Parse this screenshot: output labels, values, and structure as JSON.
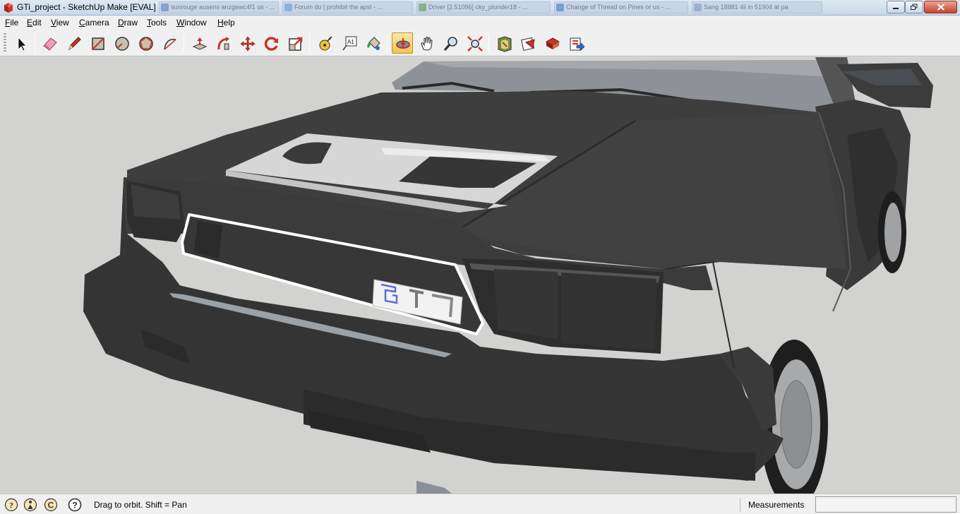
{
  "window": {
    "title": "GTi_project - SketchUp Make [EVAL]",
    "icon": "sketchup-app-icon",
    "background_tabs": [
      "sunrouge ausens anzgewc4f1 us - ...",
      "Forum do | prohibit the apsl - ...",
      "Driver [2.51096] cky_plunder18 - ...",
      "Change of Thread on Pines or us - ...",
      "Sang 18881 4li in 51904  at pa"
    ],
    "controls": [
      "minimize-icon",
      "restore-icon",
      "close-icon"
    ]
  },
  "menu": {
    "items": [
      {
        "label": "File",
        "accel": "F",
        "rest": "ile"
      },
      {
        "label": "Edit",
        "accel": "E",
        "rest": "dit"
      },
      {
        "label": "View",
        "accel": "V",
        "rest": "iew"
      },
      {
        "label": "Camera",
        "accel": "C",
        "rest": "amera"
      },
      {
        "label": "Draw",
        "accel": "D",
        "rest": "raw"
      },
      {
        "label": "Tools",
        "accel": "T",
        "rest": "ools"
      },
      {
        "label": "Window",
        "accel": "W",
        "rest": "indow"
      },
      {
        "label": "Help",
        "accel": "H",
        "rest": "elp"
      }
    ]
  },
  "toolbar": {
    "tools": [
      {
        "name": "select",
        "icon": "select-arrow-icon"
      },
      {
        "name": "eraser",
        "icon": "eraser-icon"
      },
      {
        "name": "line",
        "icon": "pencil-icon"
      },
      {
        "name": "rectangle",
        "icon": "rectangle-icon"
      },
      {
        "name": "circle",
        "icon": "circle-icon"
      },
      {
        "name": "polygon",
        "icon": "polygon-icon"
      },
      {
        "name": "arc",
        "icon": "arc-icon"
      },
      {
        "name": "push-pull",
        "icon": "push-pull-icon"
      },
      {
        "name": "follow-me",
        "icon": "follow-me-icon"
      },
      {
        "name": "move",
        "icon": "move-icon"
      },
      {
        "name": "rotate",
        "icon": "rotate-icon"
      },
      {
        "name": "scale",
        "icon": "scale-icon"
      },
      {
        "name": "tape-measure",
        "icon": "tape-measure-icon"
      },
      {
        "name": "text",
        "icon": "text-icon",
        "glyph": "A1"
      },
      {
        "name": "paint-bucket",
        "icon": "paint-bucket-icon"
      },
      {
        "name": "orbit",
        "icon": "orbit-icon",
        "active": true
      },
      {
        "name": "pan",
        "icon": "pan-hand-icon"
      },
      {
        "name": "zoom",
        "icon": "zoom-icon"
      },
      {
        "name": "zoom-extents",
        "icon": "zoom-extents-icon"
      },
      {
        "name": "3d-warehouse",
        "icon": "3d-warehouse-icon"
      },
      {
        "name": "share-component",
        "icon": "share-component-icon"
      },
      {
        "name": "extension-warehouse",
        "icon": "extension-warehouse-icon"
      },
      {
        "name": "share-model",
        "icon": "share-model-icon"
      }
    ]
  },
  "viewport": {
    "description_icon": "3d-model-viewport",
    "badge_text": "GTi"
  },
  "status": {
    "icons": [
      "geo-location-icon",
      "credits-icon",
      "copyright-icon",
      "help-icon"
    ],
    "text": "Drag to orbit.  Shift = Pan",
    "measurements_label": "Measurements",
    "measurements_value": ""
  },
  "colors": {
    "sky": "#d2d2d0",
    "car_body": "#3e3e3e",
    "hood_stripe": "#d6d6d6",
    "active_tool": "#f2c451",
    "accent_red": "#d43a2a"
  }
}
